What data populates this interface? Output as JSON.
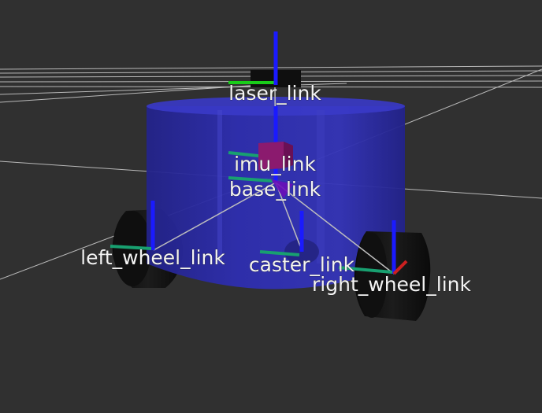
{
  "scene": {
    "background_color": "#303030",
    "grid_color": "#b5b5b5",
    "robot_body_color": "#2a2aa0",
    "wheel_color": "#121212",
    "axis_colors": {
      "x": "#cc2020",
      "y": "#19cc19",
      "z": "#1a1aff"
    },
    "imu_box_color": "#8b1a6e"
  },
  "frames": [
    {
      "id": "laser",
      "label": "laser_link"
    },
    {
      "id": "imu",
      "label": "imu_link"
    },
    {
      "id": "base",
      "label": "base_link"
    },
    {
      "id": "left_wheel",
      "label": "left_wheel_link"
    },
    {
      "id": "caster",
      "label": "caster_link"
    },
    {
      "id": "right_wheel",
      "label": "right_wheel_link"
    }
  ]
}
